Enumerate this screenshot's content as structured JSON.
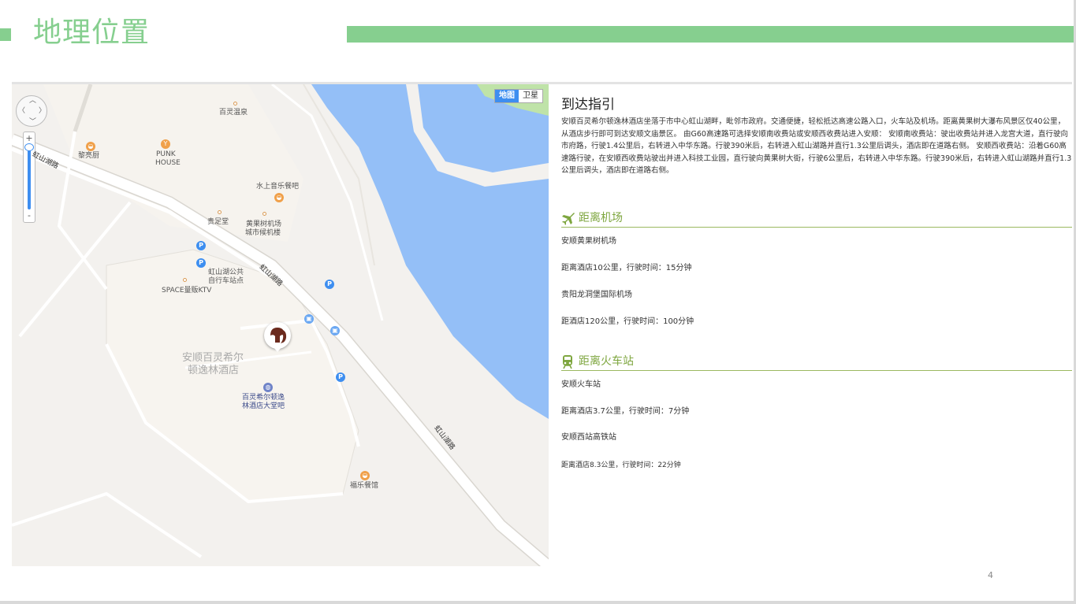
{
  "slide": {
    "title": "地理位置",
    "page_number": "4",
    "accent_color": "#86cf8f"
  },
  "map": {
    "type_switch": {
      "map_label": "地图",
      "satellite_label": "卫星",
      "selected": "地图"
    },
    "zoom": {
      "plus": "+",
      "minus": "-"
    },
    "labels": {
      "bailing_hotspring": "百灵温泉",
      "lixiang_chu": "黎亮厨",
      "punk_house_1": "PUNK",
      "punk_house_2": "HOUSE",
      "hongshanhu_road_west": "虹山湖路",
      "water_music_bar": "水上音乐餐吧",
      "guizu_tang": "贵足堂",
      "airport_terminal_1": "黄果树机场",
      "airport_terminal_2": "城市候机楼",
      "bike_station_1": "虹山湖公共",
      "bike_station_2": "自行车站点",
      "space_ktv": "SPACE量贩KTV",
      "hongshanhu_road_mid": "虹山湖路",
      "hotel_name_1": "安顺百灵希尔",
      "hotel_name_2": "顿逸林酒店",
      "lobby_bar_1": "百灵希尔顿逸",
      "lobby_bar_2": "林酒店大堂吧",
      "hongshanhu_road_south": "虹山湖路",
      "fule_restaurant": "福乐餐馆"
    },
    "colors": {
      "water": "#94bff7",
      "park": "#bfe3a8",
      "land": "#f3f1ee",
      "block": "#f7f4ef",
      "road": "#ffffff",
      "poi_food": "#f0a04a",
      "poi_parking": "#3d8ef0"
    }
  },
  "info": {
    "title": "到达指引",
    "intro": "安顺百灵希尔顿逸林酒店坐落于市中心虹山湖畔，毗邻市政府。交通便捷，轻松抵达高速公路入口，火车站及机场。距离黄果树大瀑布风景区仅40公里，从酒店步行即可到达安顺文庙景区。 由G60高速路可选择安顺南收费站或安顺西收费站进入安顺： 安顺南收费站：驶出收费站并进入龙宫大道，直行驶向市府路，行驶1.4公里后，右转进入中华东路。行驶390米后，右转进入虹山湖路并直行1.3公里后调头，酒店即在道路右侧。 安顺西收费站：沿着G60高速路行驶，在安顺西收费站驶出并进入科技工业园，直行驶向黄果树大街，行驶6公里后，右转进入中华东路。行驶390米后，右转进入虹山湖路并直行1.3公里后调头，酒店即在道路右侧。",
    "airport": {
      "heading": "距离机场",
      "icon": "airplane-icon",
      "items": [
        "安顺黄果树机场",
        "距离酒店10公里，行驶时间：15分钟",
        "贵阳龙洞堡国际机场",
        "距酒店120公里，行驶时间：100分钟"
      ]
    },
    "train": {
      "heading": "距离火车站",
      "icon": "train-icon",
      "items": [
        "安顺火车站",
        "距离酒店3.7公里，行驶时间：7分钟",
        "安顺西站高铁站",
        "距离酒店8.3公里，行驶时间：22分钟"
      ]
    },
    "heading_color": "#7ea63f"
  }
}
